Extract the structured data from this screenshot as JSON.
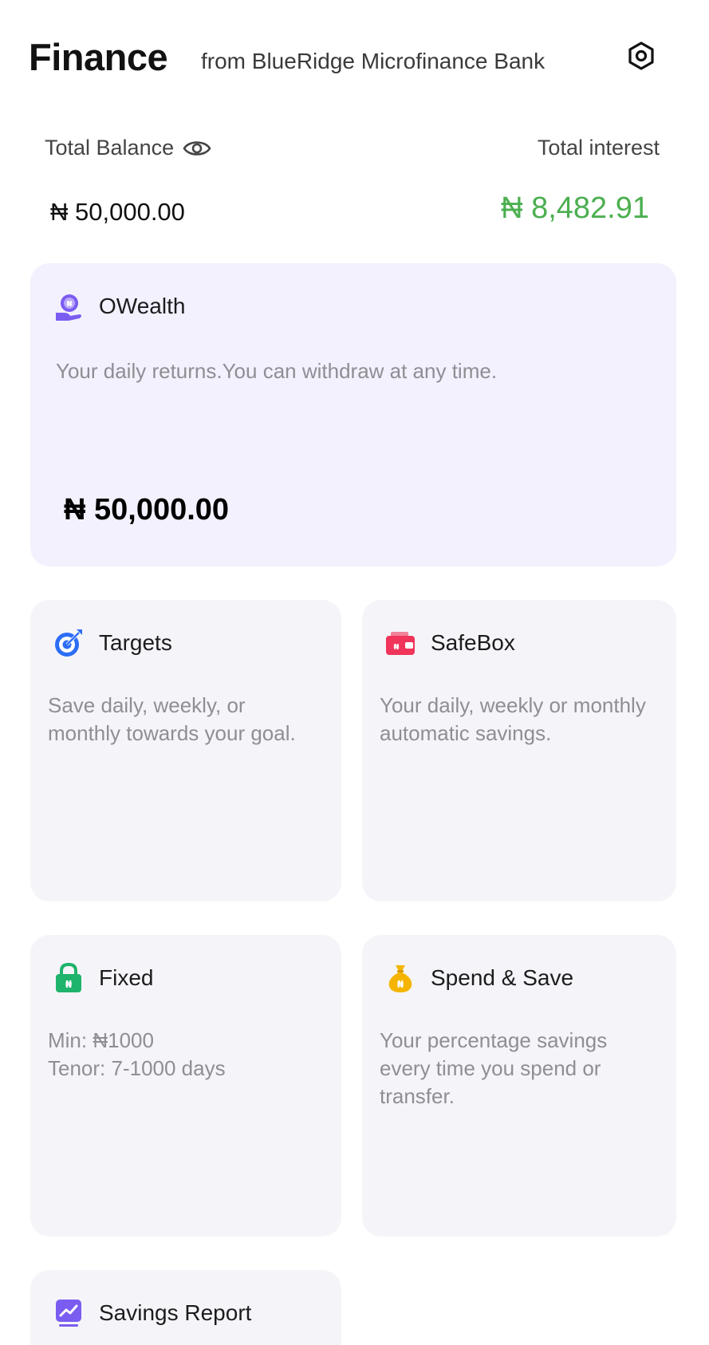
{
  "header": {
    "title": "Finance",
    "subtitle": "from BlueRidge Microfinance Bank",
    "settings_icon": "settings-hexagon-icon"
  },
  "balance": {
    "total_balance_label": "Total Balance",
    "total_balance_value": "₦ 50,000.00",
    "total_interest_label": "Total interest",
    "total_interest_value": "₦ 8,482.91"
  },
  "owealth": {
    "title": "OWealth",
    "description": "Your daily returns.You can withdraw at any time.",
    "amount": "₦ 50,000.00"
  },
  "targets": {
    "title": "Targets",
    "description": "Save daily, weekly, or monthly towards your goal."
  },
  "safebox": {
    "title": "SafeBox",
    "description": "Your daily, weekly or monthly automatic savings."
  },
  "fixed": {
    "title": "Fixed",
    "line1": "Min: ₦1000",
    "line2": "Tenor: 7-1000 days"
  },
  "spend_save": {
    "title": "Spend & Save",
    "description": "Your percentage savings every time you spend or transfer."
  },
  "savings_report": {
    "title": "Savings Report"
  },
  "colors": {
    "interest_green": "#4caf50",
    "owealth_bg": "#f2f1fd",
    "card_bg": "#f5f5f9",
    "owealth_icon": "#7b5cf0",
    "targets_icon": "#2d6df6",
    "safebox_icon": "#f0345a",
    "fixed_icon": "#1fb36b",
    "spend_icon": "#f5b400",
    "report_icon": "#7b5cf0"
  }
}
